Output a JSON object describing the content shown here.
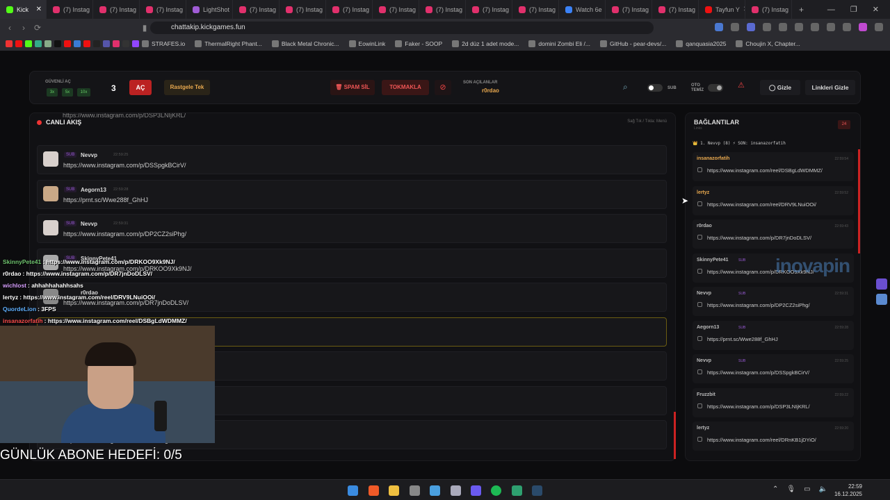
{
  "browser": {
    "tabs": [
      {
        "label": "Kick",
        "active": true,
        "color": "#53fc18"
      },
      {
        "label": "(7) Instag",
        "color": "#e1306c"
      },
      {
        "label": "(7) Instag",
        "color": "#e1306c"
      },
      {
        "label": "(7) Instag",
        "color": "#e1306c"
      },
      {
        "label": "LightShot",
        "color": "#a05cd6"
      },
      {
        "label": "(7) Instag",
        "color": "#e1306c"
      },
      {
        "label": "(7) Instag",
        "color": "#e1306c"
      },
      {
        "label": "(7) Instag",
        "color": "#e1306c"
      },
      {
        "label": "(7) Instag",
        "color": "#e1306c"
      },
      {
        "label": "(7) Instag",
        "color": "#e1306c"
      },
      {
        "label": "(7) Instag",
        "color": "#e1306c"
      },
      {
        "label": "(7) Instag",
        "color": "#e1306c"
      },
      {
        "label": "Watch 6e",
        "color": "#3b82f6"
      },
      {
        "label": "(7) Instag",
        "color": "#e1306c"
      },
      {
        "label": "(7) Instag",
        "color": "#e1306c"
      },
      {
        "label": "Tayfun Y",
        "color": "#e11"
      },
      {
        "label": "(7) Instag",
        "color": "#e1306c"
      }
    ],
    "new_tab": "+",
    "url": "chattakip.kickgames.fun",
    "bookmarks": [
      "STRAFES.io",
      "ThermalRight Phant...",
      "Black Metal Chronic...",
      "EowinLink",
      "Faker - SOOP",
      "2d düz 1 adet mode...",
      "domini Zombi Eli /...",
      "GitHub - pear-devs/...",
      "qanquasia2025",
      "Choujin X, Chapter..."
    ]
  },
  "controls": {
    "guvenli_label": "GÜVENLİ AÇ",
    "multipliers": [
      "3x",
      "5x",
      "10x"
    ],
    "count": "3",
    "ac": "AÇ",
    "rastgele": "Rastgele Tek",
    "spam": "SPAM SİL",
    "tokmakla": "TOKMAKLA",
    "son_label": "SON AÇILANLAR",
    "son_value": "r0rdao",
    "sub_label": "SUB",
    "oto_label": "OTO TEMİZ",
    "gizle": "Gizle",
    "linkleri_gizle": "Linkleri Gizle"
  },
  "feed": {
    "title": "CANLI AKIŞ",
    "hint": "Sağ Tık / Tıkla: Menü",
    "top_partial": "https://www.instagram.com/p/DSP3LNIjKRL/",
    "messages": [
      {
        "sub": "SUB",
        "user": "Nevvp",
        "time": "22:59:25",
        "link": "https://www.instagram.com/p/DSSpgkBCirV/"
      },
      {
        "sub": "SUB",
        "user": "Aegorn13",
        "time": "22:59:28",
        "link": "https://prnt.sc/Wwe288f_GhHJ"
      },
      {
        "sub": "SUB",
        "user": "Nevvp",
        "time": "22:59:31",
        "link": "https://www.instagram.com/p/DP2CZ2siPhg/"
      },
      {
        "sub": "SUB",
        "user": "SkinnyPete41",
        "time": "",
        "link": "https://www.instagram.com/p/DRKOO9Xk9NJ/"
      },
      {
        "sub": "",
        "user": "r0rdao",
        "time": "",
        "link": "https://www.instagram.com/p/DR7jnDoDLSV/"
      },
      {
        "sub": "",
        "user": "",
        "time": "",
        "link": ""
      },
      {
        "sub": "",
        "user": "",
        "time": "",
        "link": ""
      },
      {
        "sub": "",
        "user": "",
        "time": "",
        "link": ""
      },
      {
        "sub": "",
        "user": "",
        "time": "",
        "link": "https://www.instagram.com/reel/DSBgLdWDMMZ/"
      }
    ]
  },
  "links_panel": {
    "title": "BAĞLANTILAR",
    "subtitle": "Links",
    "count": "24",
    "ticker": "👑 1. Nevvp (8)          ⚡ SON: insanazorfatih",
    "items": [
      {
        "user": "insanazorfatih",
        "sub": "",
        "time": "22:59:54",
        "url": "https://www.instagram.com/reel/DSBgLdWDMMZ/",
        "gold": true
      },
      {
        "user": "lertyz",
        "sub": "",
        "time": "22:59:52",
        "url": "https://www.instagram.com/reel/DRV9LNuiOOi/",
        "gold": true
      },
      {
        "user": "r0rdao",
        "sub": "",
        "time": "22:59:43",
        "url": "https://www.instagram.com/p/DR7jnDoDLSV/",
        "gold": false
      },
      {
        "user": "SkinnyPete41",
        "sub": "SUB",
        "time": "",
        "url": "https://www.instagram.com/p/DRKOO9Xk9NJ/",
        "gold": false
      },
      {
        "user": "Nevvp",
        "sub": "SUB",
        "time": "22:59:31",
        "url": "https://www.instagram.com/p/DP2CZ2siPhg/",
        "gold": false
      },
      {
        "user": "Aegorn13",
        "sub": "SUB",
        "time": "22:59:28",
        "url": "https://prnt.sc/Wwe288f_GhHJ",
        "gold": false
      },
      {
        "user": "Nevvp",
        "sub": "SUB",
        "time": "22:59:25",
        "url": "https://www.instagram.com/p/DSSpgkBCirV/",
        "gold": false
      },
      {
        "user": "Fruzzbit",
        "sub": "",
        "time": "22:59:22",
        "url": "https://www.instagram.com/p/DSP3LNIjKRL/",
        "gold": false
      },
      {
        "user": "lertyz",
        "sub": "",
        "time": "22:59:20",
        "url": "https://www.instagram.com/reel/DRnKB1jDYiO/",
        "gold": false
      }
    ]
  },
  "stream_overlay": {
    "chat": [
      {
        "user": "SkinnyPete41",
        "color": "#6fc36f",
        "text": ": https://www.instagram.com/p/DRKOO9Xk9NJ/"
      },
      {
        "user": "r0rdao",
        "color": "#ffffff",
        "text": ": https://www.instagram.com/p/DR7jnDoDLSV/"
      },
      {
        "user": "wichlost",
        "color": "#d8a0ff",
        "text": ": ahhahhahahhsahs"
      },
      {
        "user": "lertyz",
        "color": "#ffffff",
        "text": ": https://www.instagram.com/reel/DRV9LNuiOOi/"
      },
      {
        "user": "QuordeLion",
        "color": "#5fb0ff",
        "text": ": 3FPS"
      },
      {
        "user": "insanazorfatih",
        "color": "#ff4d4d",
        "text": ": https://www.instagram.com/reel/DSBgLdWDMMZ/"
      }
    ],
    "goal": "GÜNLÜK ABONE HEDEFİ: 0/5",
    "watermark": "inovapin"
  },
  "taskbar": {
    "time": "22:59",
    "date": "16.12.2025"
  }
}
